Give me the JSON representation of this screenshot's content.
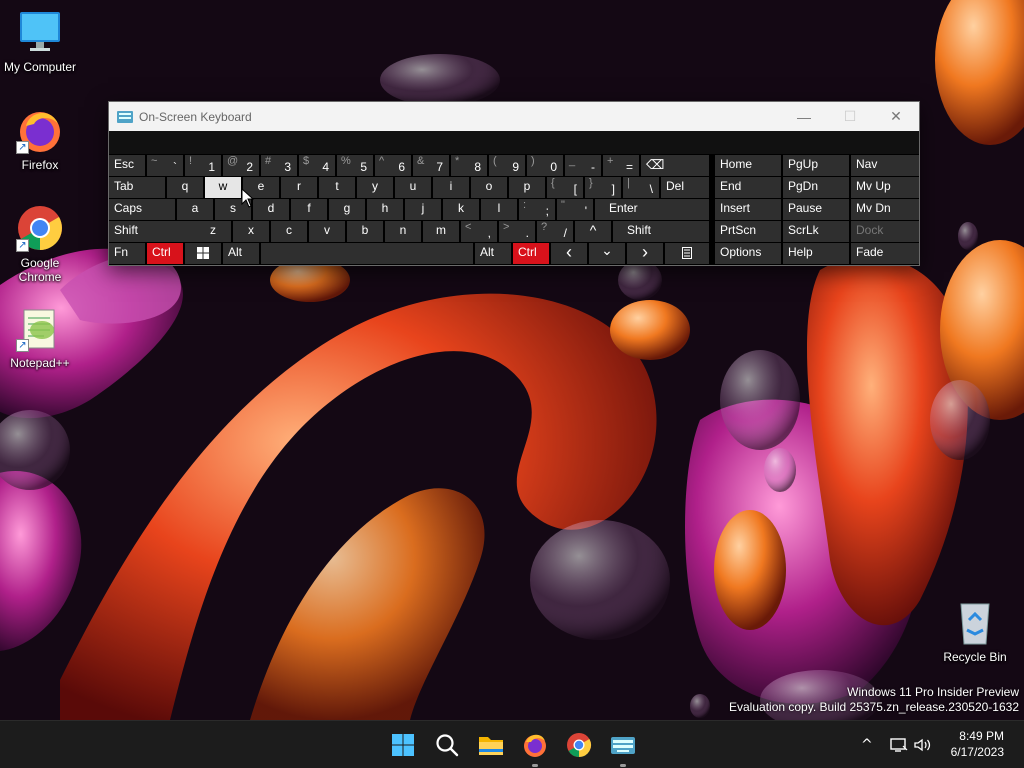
{
  "desktop": {
    "icons": [
      {
        "label": "My Computer",
        "icon": "monitor-icon"
      },
      {
        "label": "Firefox",
        "icon": "firefox-icon"
      },
      {
        "label": "Google Chrome",
        "icon": "chrome-icon"
      },
      {
        "label": "Notepad++",
        "icon": "notepadpp-icon"
      },
      {
        "label": "Recycle Bin",
        "icon": "recycle-bin-icon"
      }
    ],
    "watermark": {
      "line1": "Windows 11 Pro Insider Preview",
      "line2": "Evaluation copy. Build 25375.zn_release.230520-1632"
    }
  },
  "osk": {
    "title": "On-Screen Keyboard",
    "controls": {
      "minimize": "—",
      "maximize": "☐",
      "close": "✕"
    },
    "keys": {
      "esc": "Esc",
      "tilde_shift": "~",
      "tilde": "`",
      "d1_shift": "!",
      "d1": "1",
      "d2_shift": "@",
      "d2": "2",
      "d3_shift": "#",
      "d3": "3",
      "d4_shift": "$",
      "d4": "4",
      "d5_shift": "%",
      "d5": "5",
      "d6_shift": "^",
      "d6": "6",
      "d7_shift": "&",
      "d7": "7",
      "d8_shift": "*",
      "d8": "8",
      "d9_shift": "(",
      "d9": "9",
      "d0_shift": ")",
      "d0": "0",
      "minus_shift": "_",
      "minus": "-",
      "plus_shift": "+",
      "plus": "=",
      "backspace": "⌫",
      "home": "Home",
      "pgup": "PgUp",
      "nav": "Nav",
      "tab": "Tab",
      "q": "q",
      "w": "w",
      "e": "e",
      "r": "r",
      "t": "t",
      "y": "y",
      "u": "u",
      "i": "i",
      "o": "o",
      "p": "p",
      "lbracket_shift": "{",
      "lbracket": "[",
      "rbracket_shift": "}",
      "rbracket": "]",
      "pipe_shift": "|",
      "backslash": "\\",
      "del": "Del",
      "end": "End",
      "pgdn": "PgDn",
      "mvup": "Mv Up",
      "caps": "Caps",
      "a": "a",
      "s": "s",
      "d": "d",
      "f": "f",
      "g": "g",
      "h": "h",
      "j": "j",
      "k": "k",
      "l": "l",
      "colon_shift": ":",
      "semicolon": ";",
      "quote_shift": "\"",
      "quote": "'",
      "enter": "Enter",
      "insert": "Insert",
      "pause": "Pause",
      "mvdn": "Mv Dn",
      "shift": "Shift",
      "z": "z",
      "x": "x",
      "c": "c",
      "v": "v",
      "b": "b",
      "n": "n",
      "m": "m",
      "lt_shift": "<",
      "comma": ",",
      "gt_shift": ">",
      "period": ".",
      "question_shift": "?",
      "slash": "/",
      "up": "^",
      "shift_r": "Shift",
      "prtscn": "PrtScn",
      "scrlk": "ScrLk",
      "dock": "Dock",
      "fn": "Fn",
      "ctrl": "Ctrl",
      "alt": "Alt",
      "alt_r": "Alt",
      "ctrl_r": "Ctrl",
      "left": "‹",
      "down": "⌄",
      "right": "›",
      "options": "Options",
      "help": "Help",
      "fade": "Fade"
    }
  },
  "taskbar": {
    "apps": [
      "start-icon",
      "search-icon",
      "file-explorer-icon",
      "firefox-icon",
      "chrome-icon",
      "osk-icon"
    ],
    "clock": {
      "time": "8:49 PM",
      "date": "6/17/2023"
    },
    "tray_chevron": "^"
  }
}
